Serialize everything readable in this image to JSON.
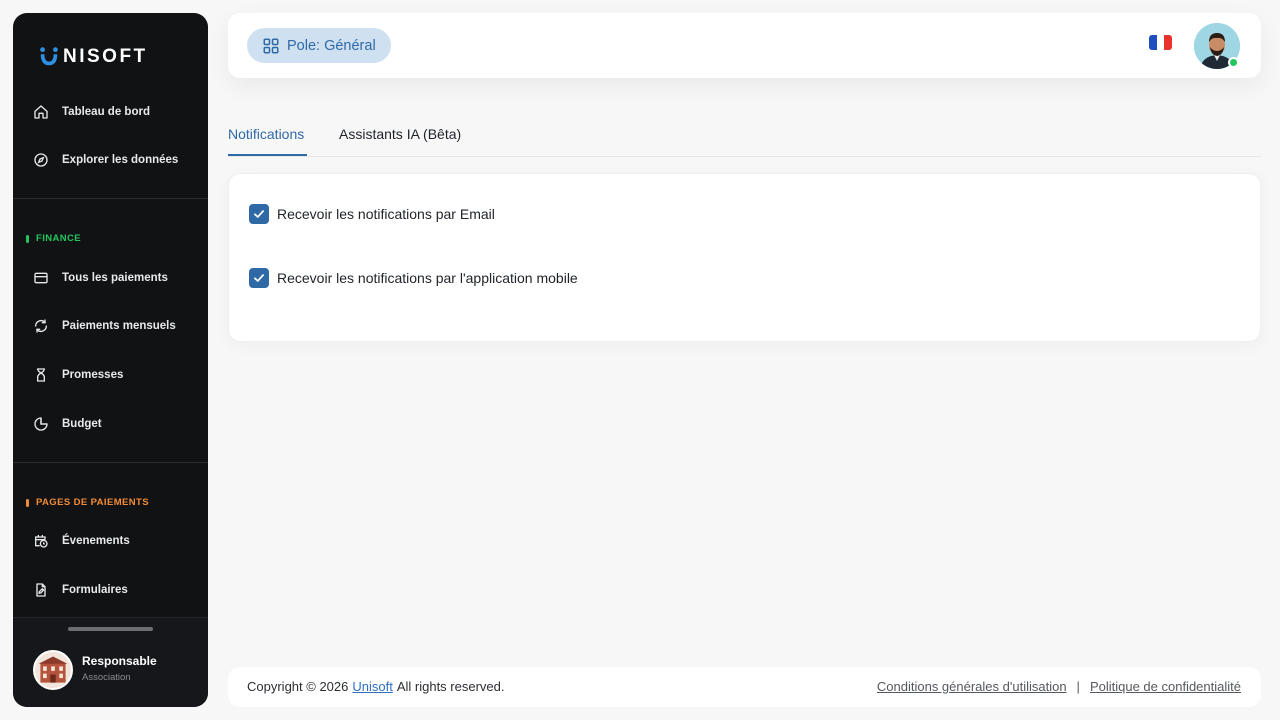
{
  "brand": {
    "name": "NISOFT",
    "logo_icon": "unisoft-u-logo"
  },
  "sidebar": {
    "top_items": [
      {
        "label": "Tableau de bord",
        "icon": "home-icon"
      },
      {
        "label": "Explorer les données",
        "icon": "compass-icon"
      }
    ],
    "sections": [
      {
        "label": "FINANCE",
        "color": "#22c55e",
        "items": [
          {
            "label": "Tous les paiements",
            "icon": "credit-card-icon"
          },
          {
            "label": "Paiements mensuels",
            "icon": "refresh-icon"
          },
          {
            "label": "Promesses",
            "icon": "hourglass-icon"
          },
          {
            "label": "Budget",
            "icon": "pie-chart-icon"
          }
        ]
      },
      {
        "label": "PAGES DE PAIEMENTS",
        "color": "#f28c38",
        "items": [
          {
            "label": "Évenements",
            "icon": "calendar-clock-icon"
          },
          {
            "label": "Formulaires",
            "icon": "document-edit-icon"
          }
        ]
      }
    ],
    "user": {
      "role": "Responsable",
      "org": "Association"
    }
  },
  "header": {
    "pole_label": "Pole: Général",
    "language_flag": "france-flag-icon"
  },
  "tabs": [
    {
      "label": "Notifications",
      "active": true
    },
    {
      "label": "Assistants IA (Bêta)",
      "active": false
    }
  ],
  "settings": {
    "options": [
      {
        "label": "Recevoir les notifications par Email",
        "checked": true
      },
      {
        "label": "Recevoir les notifications par l'application mobile",
        "checked": true
      }
    ]
  },
  "footer": {
    "copyright_prefix": "Copyright © 2026",
    "company_link": "Unisoft",
    "rights": "All rights reserved.",
    "terms_link": "Conditions générales d'utilisation",
    "separator": "|",
    "privacy_link": "Politique de confidentialité"
  },
  "colors": {
    "primary": "#2f6aa6",
    "sidebar_bg": "#111214",
    "finance_accent": "#22c55e",
    "payment_pages_accent": "#f28c38"
  }
}
